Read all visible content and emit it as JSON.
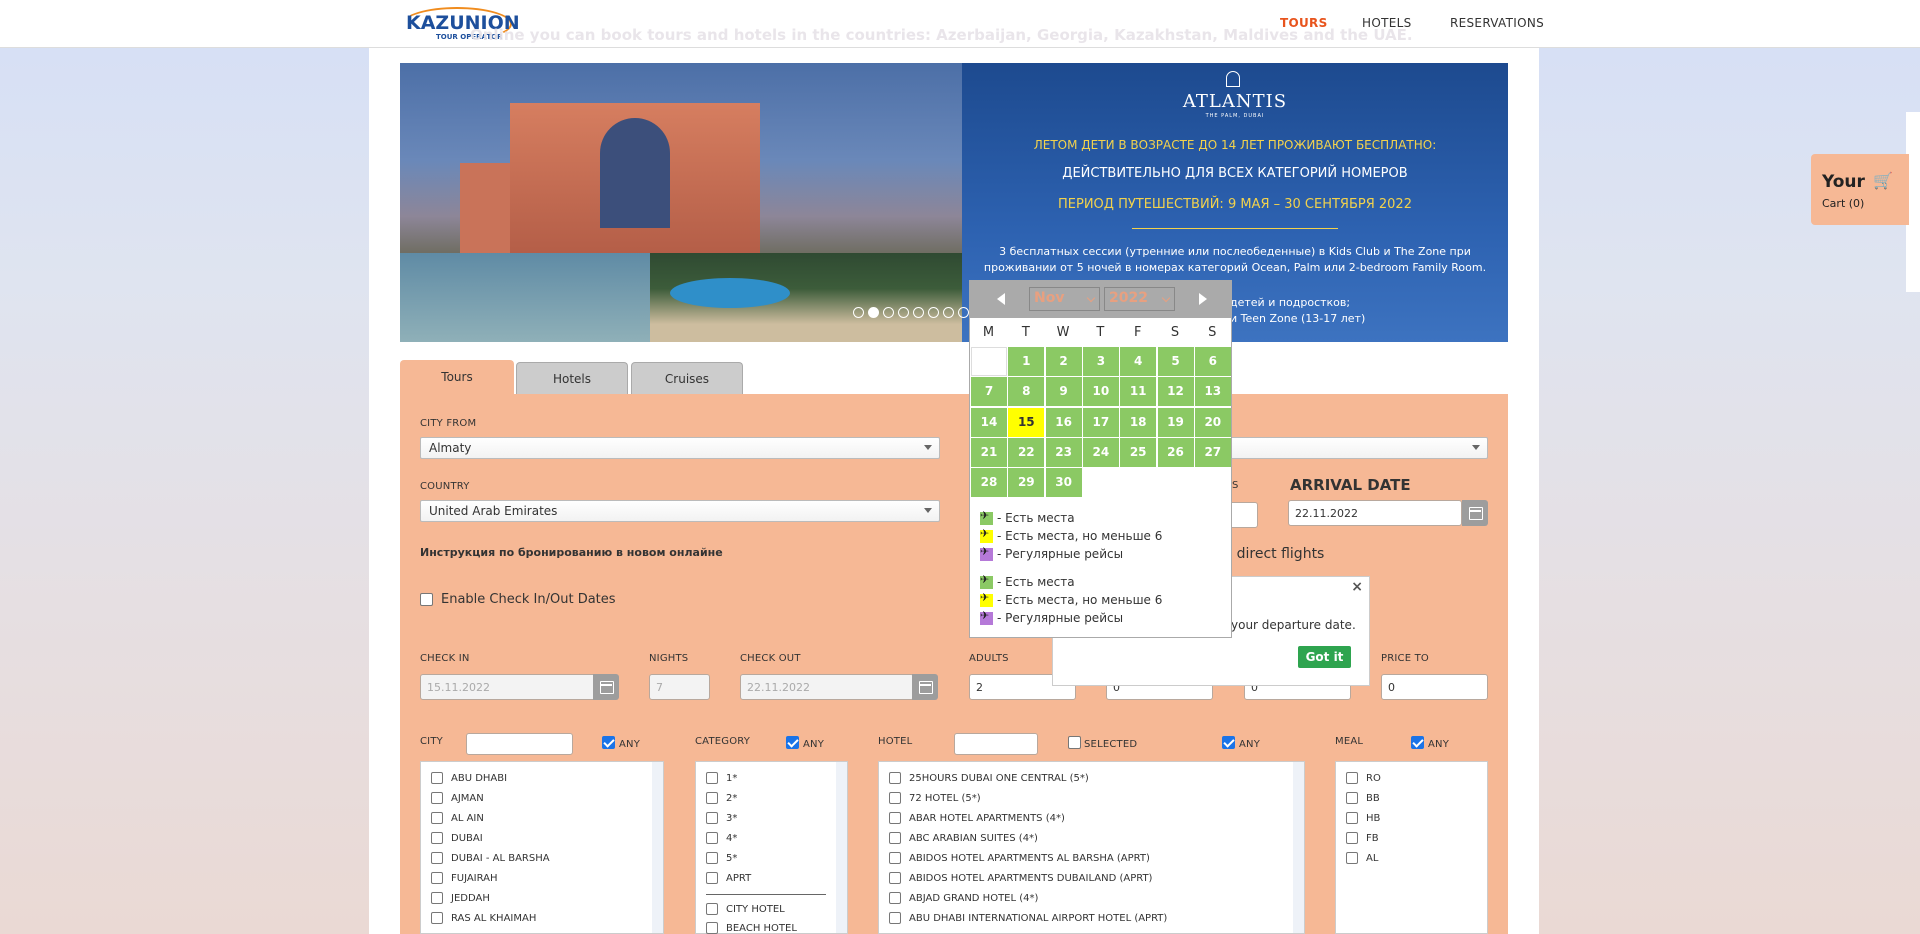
{
  "header": {
    "logo_text": "KAZUNION",
    "logo_sub": "TOUR OPERATOR",
    "nav": [
      "TOURS",
      "HOTELS",
      "RESERVATIONS"
    ]
  },
  "ghost_notice": "Online you can book tours and hotels in the countries: Azerbaijan, Georgia, Kazakhstan, Maldives and the UAE.",
  "banner": {
    "brand": "ATLANTIS",
    "brand_sub": "THE PALM, DUBAI",
    "line1": "ЛЕТОМ ДЕТИ В ВОЗРАСТЕ ДО 14 ЛЕТ ПРОЖИВАЮТ БЕСПЛАТНО:",
    "line2": "ДЕЙСТВИТЕЛЬНО ДЛЯ ВСЕХ КАТЕГОРИЙ НОМЕРОВ",
    "line3": "ПЕРИОД ПУТЕШЕСТВИЙ: 9 МАЯ – 30 СЕНТЯБРЯ 2022",
    "line4": "3 бесплатных сессии (утренние или послеобеденные) в Kids Club и The Zone при проживании от 5 ночей в номерах категорий Ocean, Palm или 2-bedroom Family Room.",
    "line5a": "детей и подростков;",
    "line5b": "и Teen Zone (13-17 лет)",
    "slides": 8,
    "active_slide": 2
  },
  "tabs": [
    "Tours",
    "Hotels",
    "Cruises"
  ],
  "form": {
    "city_from_label": "CITY FROM",
    "city_from_value": "Almaty",
    "country_label": "COUNTRY",
    "country_value": "United Arab Emirates",
    "instruction": "Инструкция по бронированию в новом онлайне",
    "enable_dates": "Enable Check In/Out Dates",
    "arrival_label": "ARRIVAL DATE",
    "arrival_value": "22.11.2022",
    "fragment_s": "S",
    "direct_flights": "ly direct flights",
    "checkin_label": "CHECK IN",
    "checkin_value": "15.11.2022",
    "nights_label": "NIGHTS",
    "nights_value": "7",
    "checkout_label": "CHECK OUT",
    "checkout_value": "22.11.2022",
    "adults_label": "ADULTS",
    "adults_value": "2",
    "kids_value": "0",
    "price_from_value": "0",
    "price_to_label": "PRICE TO",
    "price_to_value": "0"
  },
  "filters": {
    "city": {
      "label": "CITY",
      "any": "ANY",
      "items": [
        "ABU DHABI",
        "AJMAN",
        "AL AIN",
        "DUBAI",
        "DUBAI - AL BARSHA",
        "FUJAIRAH",
        "JEDDAH",
        "RAS AL KHAIMAH"
      ]
    },
    "category": {
      "label": "CATEGORY",
      "any": "ANY",
      "items": [
        "1*",
        "2*",
        "3*",
        "4*",
        "5*",
        "APRT"
      ],
      "items2": [
        "CITY HOTEL",
        "BEACH HOTEL"
      ]
    },
    "hotel": {
      "label": "HOTEL",
      "selected": "SELECTED",
      "any": "ANY",
      "items": [
        "25HOURS DUBAI ONE CENTRAL (5*)",
        "72 HOTEL (5*)",
        "ABAR HOTEL APARTMENTS (4*)",
        "ABC ARABIAN SUITES (4*)",
        "ABIDOS HOTEL APARTMENTS AL BARSHA (APRT)",
        "ABIDOS HOTEL APARTMENTS DUBAILAND (APRT)",
        "ABJAD GRAND HOTEL (4*)",
        "ABU DHABI INTERNATIONAL AIRPORT HOTEL (APRT)"
      ]
    },
    "meal": {
      "label": "MEAL",
      "any": "ANY",
      "items": [
        "RO",
        "BB",
        "HB",
        "FB",
        "AL"
      ]
    }
  },
  "datepicker": {
    "month": "Nov",
    "year": "2022",
    "dow": [
      "M",
      "T",
      "W",
      "T",
      "F",
      "S",
      "S"
    ],
    "days": [
      "1",
      "2",
      "3",
      "4",
      "5",
      "6",
      "7",
      "8",
      "9",
      "10",
      "11",
      "12",
      "13",
      "14",
      "15",
      "16",
      "17",
      "18",
      "19",
      "20",
      "21",
      "22",
      "23",
      "24",
      "25",
      "26",
      "27",
      "28",
      "29",
      "30"
    ],
    "highlight": "15",
    "legend": [
      "- Есть места",
      "- Есть места, но меньше 6",
      "- Регулярные рейсы",
      "- Есть места",
      "- Есть места, но меньше 6",
      "- Регулярные рейсы"
    ]
  },
  "popover": {
    "text": "your departure date.",
    "button": "Got it",
    "close": "×"
  },
  "cart": {
    "title": "Your",
    "count": "Cart (0)"
  }
}
